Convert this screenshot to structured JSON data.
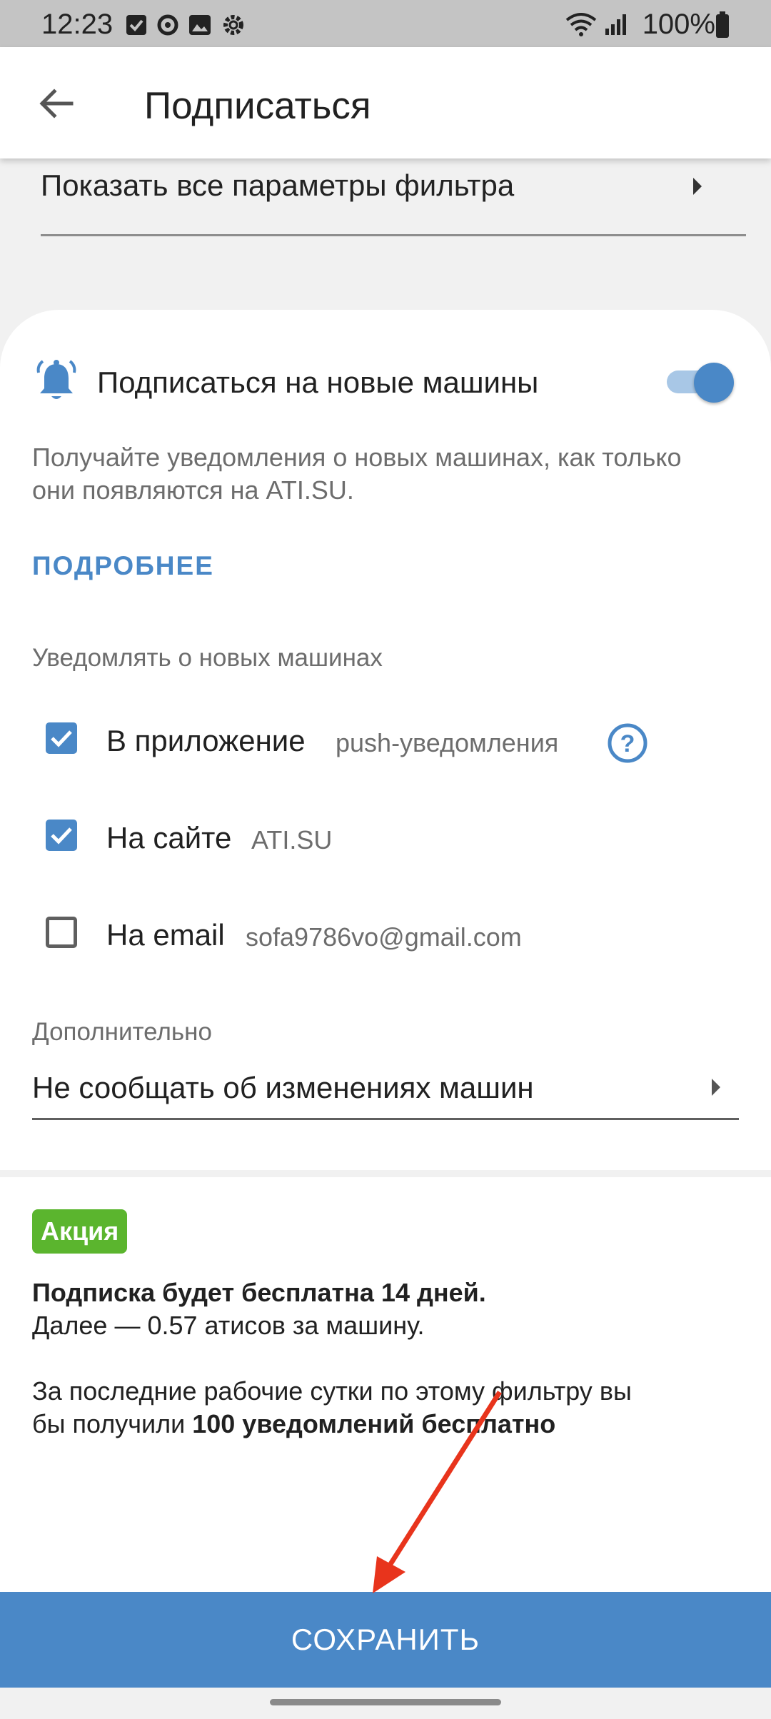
{
  "status_bar": {
    "time": "12:23",
    "battery": "100%",
    "icons": [
      "checkbox-notification-icon",
      "sync-icon",
      "image-icon",
      "settings-icon",
      "wifi-icon",
      "signal-icon",
      "battery-icon"
    ]
  },
  "app_bar": {
    "title": "Подписаться",
    "back_icon": "arrow-back-icon"
  },
  "filter_row": {
    "label": "Показать все параметры фильтра"
  },
  "subscription": {
    "title": "Подписаться на новые машины",
    "toggle_on": true,
    "description": "Получайте уведомления о новых машинах, как только они появляются на ATI.SU.",
    "more_link": "ПОДРОБНЕЕ"
  },
  "notify": {
    "label": "Уведомлять о новых машинах",
    "options": [
      {
        "label": "В приложение",
        "hint": "push-уведомления",
        "checked": true
      },
      {
        "label": "На сайте",
        "hint": "ATI.SU",
        "checked": true
      },
      {
        "label": "На email",
        "hint": "sofa9786vo@gmail.com",
        "checked": false
      }
    ]
  },
  "extra": {
    "label": "Дополнительно",
    "value": "Не сообщать об изменениях машин"
  },
  "promo": {
    "badge": "Акция",
    "line1_bold": "Подписка будет бесплатна 14 дней.",
    "line2": "Далее — 0.57 атисов за машину.",
    "line3": "За последние рабочие сутки по этому фильтру вы",
    "line4_prefix": "бы получили",
    "line4_bold": "100 уведомлений бесплатно"
  },
  "save_button": {
    "label": "СОХРАНИТЬ"
  },
  "colors": {
    "accent": "#4a88c7",
    "badge_green": "#5bb52e",
    "arrow_red": "#e8341c"
  }
}
